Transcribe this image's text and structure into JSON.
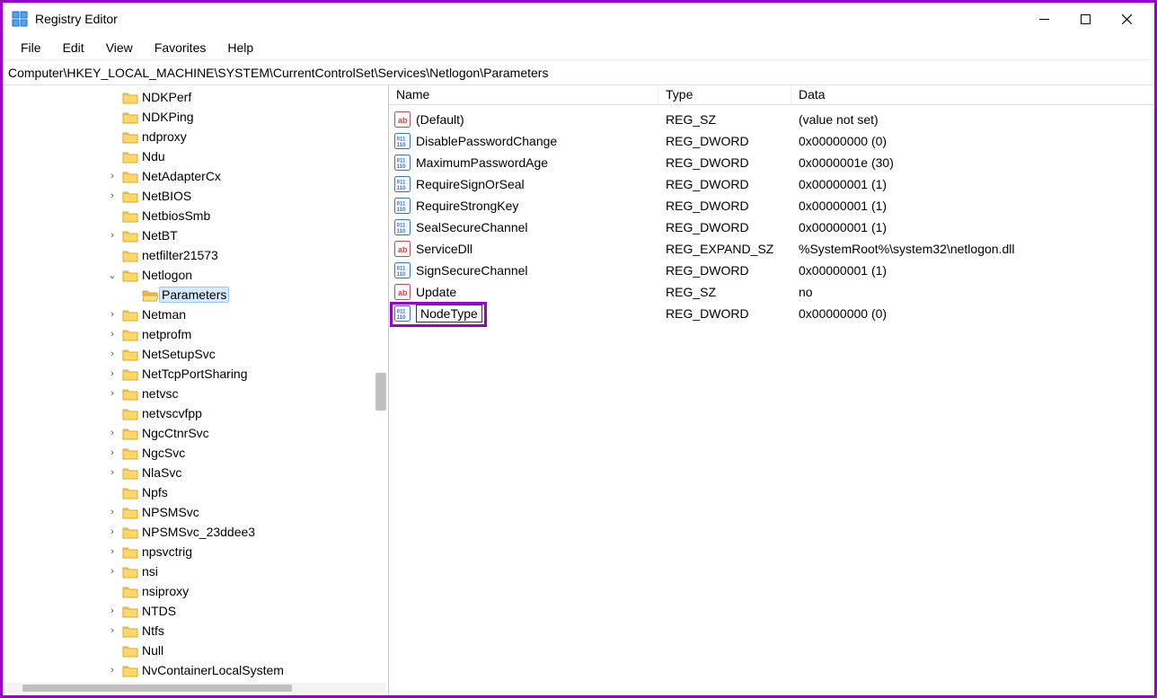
{
  "window": {
    "title": "Registry Editor"
  },
  "menu": {
    "file": "File",
    "edit": "Edit",
    "view": "View",
    "favorites": "Favorites",
    "help": "Help"
  },
  "address": "Computer\\HKEY_LOCAL_MACHINE\\SYSTEM\\CurrentControlSet\\Services\\Netlogon\\Parameters",
  "tree": [
    {
      "label": "NDKPerf",
      "chev": "leaf",
      "indent": 0
    },
    {
      "label": "NDKPing",
      "chev": "leaf",
      "indent": 0
    },
    {
      "label": "ndproxy",
      "chev": "leaf",
      "indent": 0
    },
    {
      "label": "Ndu",
      "chev": "leaf",
      "indent": 0
    },
    {
      "label": "NetAdapterCx",
      "chev": "collapsed",
      "indent": 0
    },
    {
      "label": "NetBIOS",
      "chev": "collapsed",
      "indent": 0
    },
    {
      "label": "NetbiosSmb",
      "chev": "leaf",
      "indent": 0
    },
    {
      "label": "NetBT",
      "chev": "collapsed",
      "indent": 0
    },
    {
      "label": "netfilter21573",
      "chev": "leaf",
      "indent": 0
    },
    {
      "label": "Netlogon",
      "chev": "expanded",
      "indent": 0
    },
    {
      "label": "Parameters",
      "chev": "leaf",
      "indent": 1,
      "selected": true,
      "open": true
    },
    {
      "label": "Netman",
      "chev": "collapsed",
      "indent": 0
    },
    {
      "label": "netprofm",
      "chev": "collapsed",
      "indent": 0
    },
    {
      "label": "NetSetupSvc",
      "chev": "collapsed",
      "indent": 0
    },
    {
      "label": "NetTcpPortSharing",
      "chev": "collapsed",
      "indent": 0
    },
    {
      "label": "netvsc",
      "chev": "collapsed",
      "indent": 0
    },
    {
      "label": "netvscvfpp",
      "chev": "leaf",
      "indent": 0
    },
    {
      "label": "NgcCtnrSvc",
      "chev": "collapsed",
      "indent": 0
    },
    {
      "label": "NgcSvc",
      "chev": "collapsed",
      "indent": 0
    },
    {
      "label": "NlaSvc",
      "chev": "collapsed",
      "indent": 0
    },
    {
      "label": "Npfs",
      "chev": "leaf",
      "indent": 0
    },
    {
      "label": "NPSMSvc",
      "chev": "collapsed",
      "indent": 0
    },
    {
      "label": "NPSMSvc_23ddee3",
      "chev": "collapsed",
      "indent": 0
    },
    {
      "label": "npsvctrig",
      "chev": "collapsed",
      "indent": 0
    },
    {
      "label": "nsi",
      "chev": "collapsed",
      "indent": 0
    },
    {
      "label": "nsiproxy",
      "chev": "leaf",
      "indent": 0
    },
    {
      "label": "NTDS",
      "chev": "collapsed",
      "indent": 0
    },
    {
      "label": "Ntfs",
      "chev": "collapsed",
      "indent": 0
    },
    {
      "label": "Null",
      "chev": "leaf",
      "indent": 0
    },
    {
      "label": "NvContainerLocalSystem",
      "chev": "collapsed",
      "indent": 0
    }
  ],
  "columns": {
    "name": "Name",
    "type": "Type",
    "data": "Data"
  },
  "values": [
    {
      "icon": "sz",
      "name": "(Default)",
      "type": "REG_SZ",
      "data": "(value not set)"
    },
    {
      "icon": "dw",
      "name": "DisablePasswordChange",
      "type": "REG_DWORD",
      "data": "0x00000000 (0)"
    },
    {
      "icon": "dw",
      "name": "MaximumPasswordAge",
      "type": "REG_DWORD",
      "data": "0x0000001e (30)"
    },
    {
      "icon": "dw",
      "name": "RequireSignOrSeal",
      "type": "REG_DWORD",
      "data": "0x00000001 (1)"
    },
    {
      "icon": "dw",
      "name": "RequireStrongKey",
      "type": "REG_DWORD",
      "data": "0x00000001 (1)"
    },
    {
      "icon": "dw",
      "name": "SealSecureChannel",
      "type": "REG_DWORD",
      "data": "0x00000001 (1)"
    },
    {
      "icon": "sz",
      "name": "ServiceDll",
      "type": "REG_EXPAND_SZ",
      "data": "%SystemRoot%\\system32\\netlogon.dll"
    },
    {
      "icon": "dw",
      "name": "SignSecureChannel",
      "type": "REG_DWORD",
      "data": "0x00000001 (1)"
    },
    {
      "icon": "sz",
      "name": "Update",
      "type": "REG_SZ",
      "data": "no"
    },
    {
      "icon": "dw",
      "name": "NodeType",
      "type": "REG_DWORD",
      "data": "0x00000000 (0)",
      "editing": true
    }
  ]
}
